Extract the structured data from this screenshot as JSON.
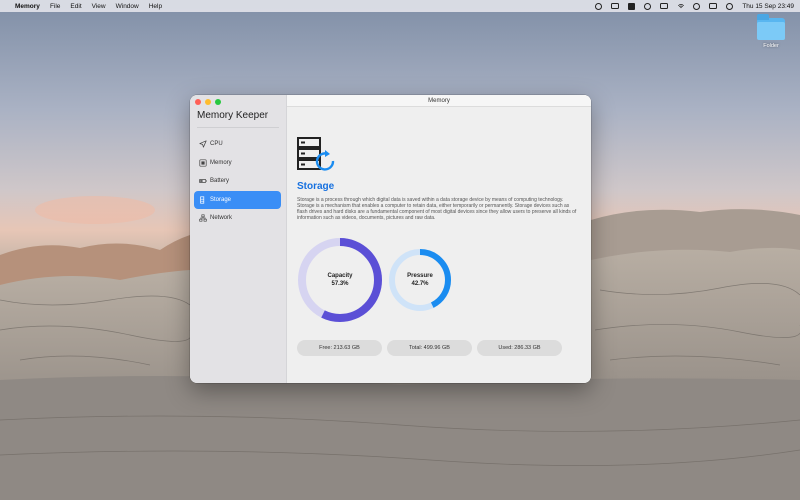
{
  "menubar": {
    "app_name": "Memory",
    "menus": [
      "File",
      "Edit",
      "View",
      "Window",
      "Help"
    ],
    "clock": "Thu 15 Sep  23:49"
  },
  "desktop": {
    "folder_label": "Folder"
  },
  "window": {
    "title": "Memory",
    "sidebar": {
      "title": "Memory Keeper",
      "items": [
        {
          "label": "CPU",
          "icon": "location-arrow-icon",
          "active": false
        },
        {
          "label": "Memory",
          "icon": "memory-chip-icon",
          "active": false
        },
        {
          "label": "Battery",
          "icon": "battery-icon",
          "active": false
        },
        {
          "label": "Storage",
          "icon": "storage-icon",
          "active": true
        },
        {
          "label": "Network",
          "icon": "network-icon",
          "active": false
        }
      ]
    },
    "content": {
      "heading": "Storage",
      "description": "Storage is a process through which digital data is saved within a data storage device by means of computing technology. Storage is a mechanism that enables a computer to retain data, either temporarily or permanently. Storage devices such as flash drives and hard disks are a fundamental component of most digital devices since they allow users to preserve all kinds of information such as videos, documents, pictures and raw data.",
      "capacity": {
        "label": "Capacity",
        "value_text": "57.3%",
        "value": 57.3,
        "color": "#5b4fd6"
      },
      "pressure": {
        "label": "Pressure",
        "value_text": "42.7%",
        "value": 42.7,
        "color": "#1a8cf0"
      },
      "stats": {
        "free": "Free: 213.63 GB",
        "total": "Total: 499.96 GB",
        "used": "Used: 286.33 GB"
      }
    }
  },
  "colors": {
    "accent": "#3a8ef6",
    "heading": "#1670df"
  }
}
